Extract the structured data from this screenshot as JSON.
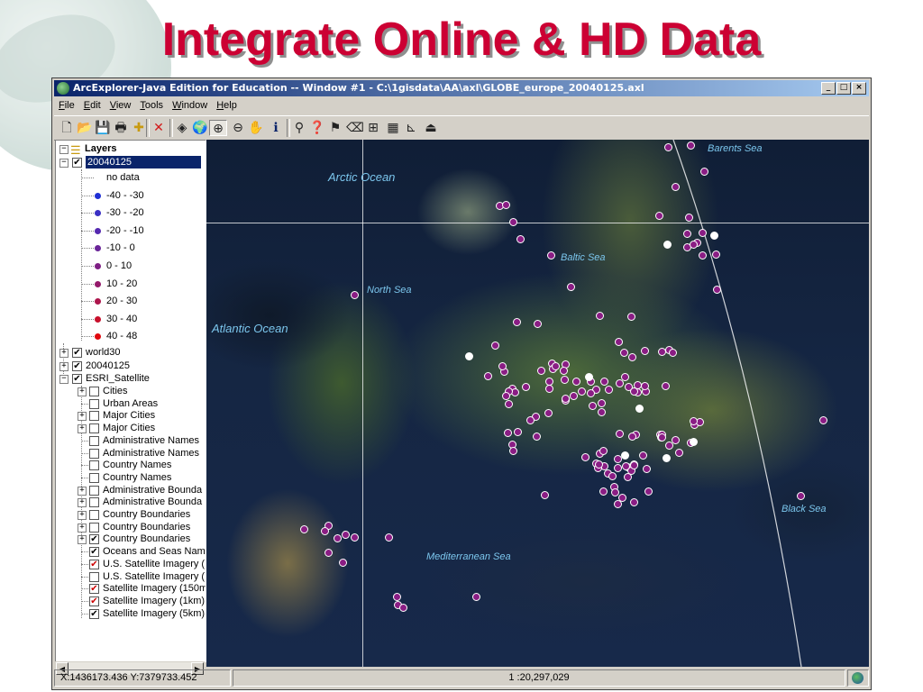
{
  "slide": {
    "title": "Integrate Online & HD Data"
  },
  "window": {
    "title": "ArcExplorer-Java Edition for Education -- Window #1 - C:\\1gisdata\\AA\\axl\\GLOBE_europe_20040125.axl",
    "controls": [
      "_",
      "□",
      "×"
    ]
  },
  "menu": [
    "File",
    "Edit",
    "View",
    "Tools",
    "Window",
    "Help"
  ],
  "toolbar": {
    "icons": [
      "new-document-icon",
      "open-folder-icon",
      "save-icon",
      "print-icon",
      "add-layer-icon",
      "remove-layer-icon",
      "zoom-extent-icon",
      "zoom-globe-icon",
      "zoom-in-icon",
      "zoom-out-icon",
      "pan-hand-icon",
      "identify-icon",
      "find-icon",
      "query-icon",
      "hyperlink-icon",
      "erase-icon",
      "measure-icon",
      "attribute-table-icon",
      "legend-icon",
      "export-icon"
    ],
    "glyphs": [
      "🗋",
      "📂",
      "💾",
      "🖶",
      "✚",
      "✕",
      "◈",
      "🌍",
      "⊕",
      "⊖",
      "✋",
      "ℹ",
      "⚲",
      "❓",
      "⚑",
      "⌫",
      "⊞",
      "▦",
      "⊾",
      "⏏"
    ]
  },
  "layers": {
    "root_label": "Layers",
    "active_layer": "20040125",
    "legend": [
      {
        "label": "no data",
        "color": ""
      },
      {
        "label": "-40 - -30",
        "color": "#1f2fd4"
      },
      {
        "label": "-30 - -20",
        "color": "#3a2fc4"
      },
      {
        "label": "-20 - -10",
        "color": "#5529b0"
      },
      {
        "label": "-10 - 0",
        "color": "#6a2498"
      },
      {
        "label": "0 - 10",
        "color": "#7e1f84"
      },
      {
        "label": "10 - 20",
        "color": "#94196a"
      },
      {
        "label": "20 - 30",
        "color": "#ad154c"
      },
      {
        "label": "30 - 40",
        "color": "#c8102c"
      },
      {
        "label": "40 - 48",
        "color": "#e0080e"
      }
    ],
    "top_layers": [
      {
        "label": "world30",
        "checked": true
      },
      {
        "label": "20040125",
        "checked": true
      },
      {
        "label": "ESRI_Satellite",
        "checked": true
      }
    ],
    "satellite_sublayers": [
      {
        "label": "Cities",
        "checked": false,
        "expandable": true
      },
      {
        "label": "Urban Areas",
        "checked": false,
        "expandable": false
      },
      {
        "label": "Major Cities",
        "checked": false,
        "expandable": true
      },
      {
        "label": "Major Cities",
        "checked": false,
        "expandable": true
      },
      {
        "label": "Administrative Names",
        "checked": false,
        "expandable": false
      },
      {
        "label": "Administrative Names",
        "checked": false,
        "expandable": false
      },
      {
        "label": "Country Names",
        "checked": false,
        "expandable": false
      },
      {
        "label": "Country Names",
        "checked": false,
        "expandable": false
      },
      {
        "label": "Administrative Bounda",
        "checked": false,
        "expandable": true
      },
      {
        "label": "Administrative Bounda",
        "checked": false,
        "expandable": true
      },
      {
        "label": "Country Boundaries",
        "checked": false,
        "expandable": true
      },
      {
        "label": "Country Boundaries",
        "checked": false,
        "expandable": true
      },
      {
        "label": "Country Boundaries",
        "checked": true,
        "expandable": true
      },
      {
        "label": "Oceans and Seas Nam",
        "checked": true,
        "expandable": false
      },
      {
        "label": "U.S. Satellite Imagery (",
        "checked": "red",
        "expandable": false
      },
      {
        "label": "U.S. Satellite Imagery (",
        "checked": false,
        "expandable": false
      },
      {
        "label": "Satellite Imagery (150m",
        "checked": "red",
        "expandable": false
      },
      {
        "label": "Satellite Imagery (1km)",
        "checked": "red",
        "expandable": false
      },
      {
        "label": "Satellite Imagery (5km)",
        "checked": true,
        "expandable": false
      }
    ]
  },
  "map": {
    "labels": [
      {
        "name": "Barents Sea",
        "size": 11
      },
      {
        "name": "Arctic Ocean",
        "size": 13
      },
      {
        "name": "Baltic Sea",
        "size": 11
      },
      {
        "name": "North Sea",
        "size": 11
      },
      {
        "name": "Atlantic Ocean",
        "size": 13
      },
      {
        "name": "Black Sea",
        "size": 11
      },
      {
        "name": "Mediterranean Sea",
        "size": 11
      }
    ],
    "point_colors": {
      "station": "#8a1d84",
      "no_data": "#ffffff"
    }
  },
  "status": {
    "coordinates": "X:1436173.436 Y:7379733.452",
    "scale": "1 :20,297,029"
  }
}
